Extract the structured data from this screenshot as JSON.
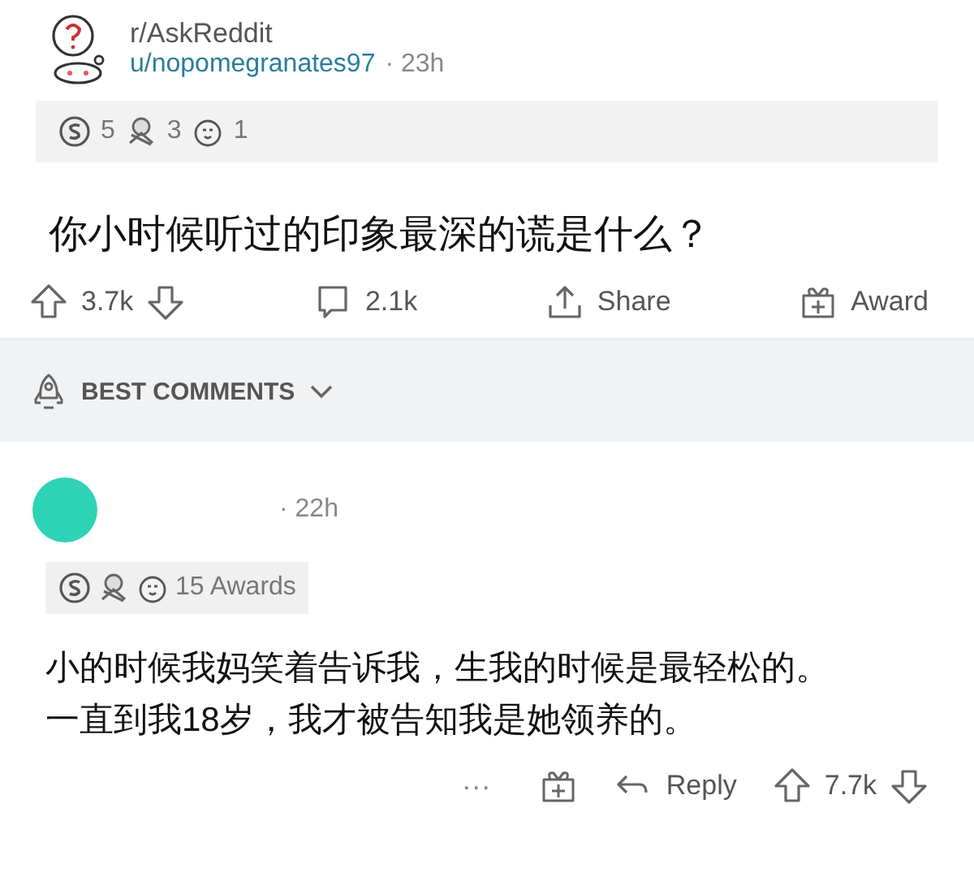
{
  "post": {
    "subreddit": "r/AskReddit",
    "author": "u/nopomegranates97",
    "time": "· 23h",
    "awards": [
      {
        "kind": "silver",
        "count": "5"
      },
      {
        "kind": "wholesome",
        "count": "3"
      },
      {
        "kind": "laugh",
        "count": "1"
      }
    ],
    "title": "你小时候听过的印象最深的谎是什么？",
    "actions": {
      "upvotes": "3.7k",
      "comments": "2.1k",
      "share": "Share",
      "award": "Award"
    }
  },
  "sort": {
    "label": "BEST COMMENTS"
  },
  "comment": {
    "time": "· 22h",
    "awards": [
      {
        "kind": "silver"
      },
      {
        "kind": "wholesome"
      },
      {
        "kind": "laugh"
      }
    ],
    "awards_label": "15 Awards",
    "lines": [
      "小的时候我妈笑着告诉我，生我的时候是最轻松的。",
      "一直到我18岁，我才被告知我是她领养的。"
    ],
    "more": "···",
    "reply": "Reply",
    "votes": "7.7k"
  }
}
